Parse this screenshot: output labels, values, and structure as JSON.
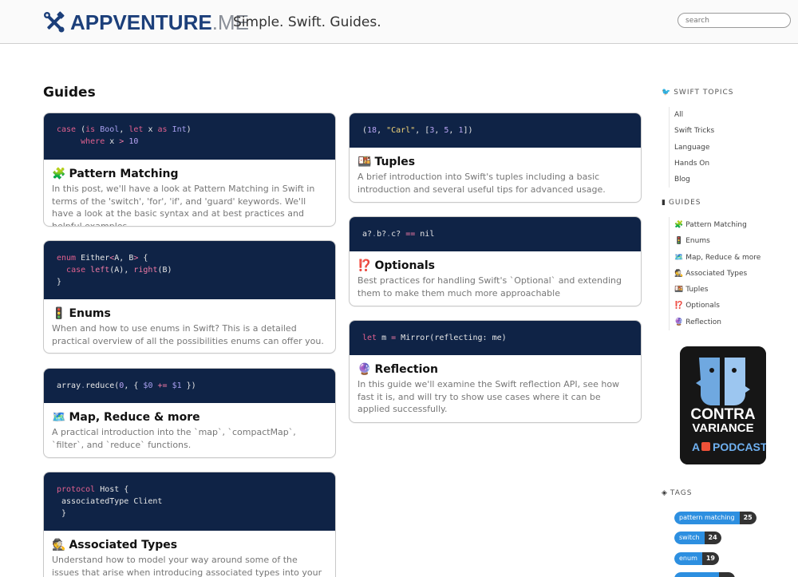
{
  "header": {
    "brand_bold": "APPVENTURE",
    "brand_light": ".ME",
    "tagline": "Simple. Swift. Guides.",
    "search_placeholder": "search"
  },
  "page_title": "Guides",
  "cards_left": [
    {
      "title_emoji": "🧩",
      "title": "Pattern Matching",
      "description": "In this post, we'll have a look at Pattern Matching in Swift in terms of the 'switch', 'for', 'if', and 'guard' keywords. We'll have a look at the basic syntax and at best practices and helpful examples."
    },
    {
      "title_emoji": "🚦",
      "title": "Enums",
      "description": "When and how to use enums in Swift? This is a detailed practical overview of all the possibilities enums can offer you."
    },
    {
      "title_emoji": "🗺️",
      "title": "Map, Reduce & more",
      "description": "A practical introduction into the `map`, `compactMap`, `filter`, and `reduce` functions."
    },
    {
      "title_emoji": "🕵️",
      "title": "Associated Types",
      "description": "Understand how to model your way around some of the issues that arise when introducing associated types into your protocols"
    }
  ],
  "cards_right": [
    {
      "title_emoji": "🍱",
      "title": "Tuples",
      "description": "A brief introduction into Swift's tuples including a basic introduction and several useful tips for advanced usage."
    },
    {
      "title_emoji": "⁉️",
      "title": "Optionals",
      "description": "Best practices for handling Swift's `Optional` and extending them to make them much more approachable"
    },
    {
      "title_emoji": "🔮",
      "title": "Reflection",
      "description": "In this guide we'll examine the Swift reflection API, see how fast it is, and will try to show use cases where it can be applied successfully."
    }
  ],
  "sidebar": {
    "topics_heading": "SWIFT TOPICS",
    "topics": [
      "All",
      "Swift Tricks",
      "Language",
      "Hands On",
      "Blog"
    ],
    "guides_heading": "GUIDES",
    "guides": [
      {
        "emoji": "🧩",
        "label": "Pattern Matching"
      },
      {
        "emoji": "🚦",
        "label": "Enums"
      },
      {
        "emoji": "🗺️",
        "label": "Map, Reduce & more"
      },
      {
        "emoji": "🕵️",
        "label": "Associated Types"
      },
      {
        "emoji": "🍱",
        "label": "Tuples"
      },
      {
        "emoji": "⁉️",
        "label": "Optionals"
      },
      {
        "emoji": "🔮",
        "label": "Reflection"
      }
    ],
    "podcast": {
      "line1": "CONTRA",
      "line2": "VARIANCE",
      "prefix": "A",
      "suffix": "PODCAST"
    },
    "tags_heading": "TAGS",
    "tags": [
      {
        "name": "pattern matching",
        "count": "25"
      },
      {
        "name": "switch",
        "count": "24"
      },
      {
        "name": "enum",
        "count": "19"
      }
    ]
  },
  "colors": {
    "code_background": "#0f2346",
    "brand_blue": "#1c3f7a",
    "tag_blue": "#2d8fe0"
  }
}
